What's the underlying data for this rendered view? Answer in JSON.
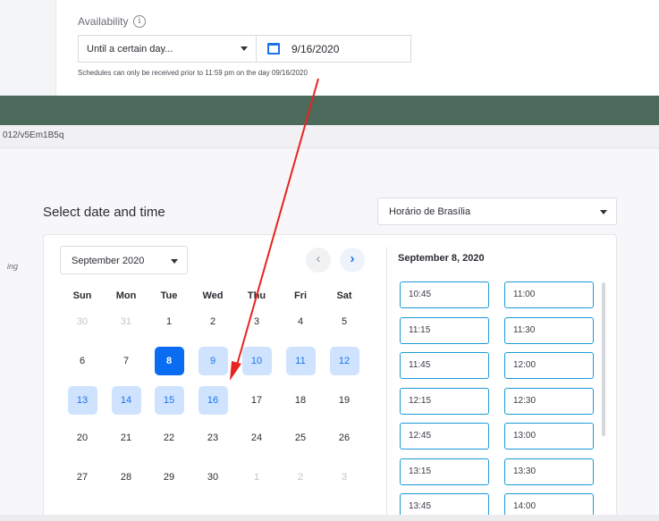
{
  "availability": {
    "label": "Availability",
    "info_glyph": "i",
    "mode": "Until a certain day...",
    "date": "9/16/2020",
    "note": "Schedules can only be received prior to 11:59 pm on the day 09/16/2020"
  },
  "browser": {
    "url_fragment": "012/v5Em1B5q"
  },
  "left_fragment": "ing",
  "scheduler": {
    "title": "Select date and time",
    "timezone": "Horário de Brasília",
    "month": "September 2020",
    "prev_glyph": "‹",
    "next_glyph": "›",
    "weekdays": [
      "Sun",
      "Mon",
      "Tue",
      "Wed",
      "Thu",
      "Fri",
      "Sat"
    ],
    "weeks": [
      [
        {
          "d": "30",
          "s": "muted"
        },
        {
          "d": "31",
          "s": "muted"
        },
        {
          "d": "1",
          "s": ""
        },
        {
          "d": "2",
          "s": ""
        },
        {
          "d": "3",
          "s": ""
        },
        {
          "d": "4",
          "s": ""
        },
        {
          "d": "5",
          "s": ""
        }
      ],
      [
        {
          "d": "6",
          "s": ""
        },
        {
          "d": "7",
          "s": ""
        },
        {
          "d": "8",
          "s": "selected"
        },
        {
          "d": "9",
          "s": "avail"
        },
        {
          "d": "10",
          "s": "avail"
        },
        {
          "d": "11",
          "s": "avail"
        },
        {
          "d": "12",
          "s": "avail"
        }
      ],
      [
        {
          "d": "13",
          "s": "avail"
        },
        {
          "d": "14",
          "s": "avail"
        },
        {
          "d": "15",
          "s": "avail"
        },
        {
          "d": "16",
          "s": "avail"
        },
        {
          "d": "17",
          "s": ""
        },
        {
          "d": "18",
          "s": ""
        },
        {
          "d": "19",
          "s": ""
        }
      ],
      [
        {
          "d": "20",
          "s": ""
        },
        {
          "d": "21",
          "s": ""
        },
        {
          "d": "22",
          "s": ""
        },
        {
          "d": "23",
          "s": ""
        },
        {
          "d": "24",
          "s": ""
        },
        {
          "d": "25",
          "s": ""
        },
        {
          "d": "26",
          "s": ""
        }
      ],
      [
        {
          "d": "27",
          "s": ""
        },
        {
          "d": "28",
          "s": ""
        },
        {
          "d": "29",
          "s": ""
        },
        {
          "d": "30",
          "s": ""
        },
        {
          "d": "1",
          "s": "muted"
        },
        {
          "d": "2",
          "s": "muted"
        },
        {
          "d": "3",
          "s": "muted"
        }
      ]
    ],
    "selected_date": "September 8, 2020",
    "time_slots": [
      "10:45",
      "11:00",
      "11:15",
      "11:30",
      "11:45",
      "12:00",
      "12:15",
      "12:30",
      "12:45",
      "13:00",
      "13:15",
      "13:30",
      "13:45",
      "14:00"
    ]
  },
  "colors": {
    "accent": "#1a73e8",
    "selected_day": "#0a6cf0",
    "available_day": "#cfe3ff",
    "slot_border": "#1a9bd6",
    "band": "#4d6b5c",
    "annotation_arrow": "#e8231f"
  }
}
